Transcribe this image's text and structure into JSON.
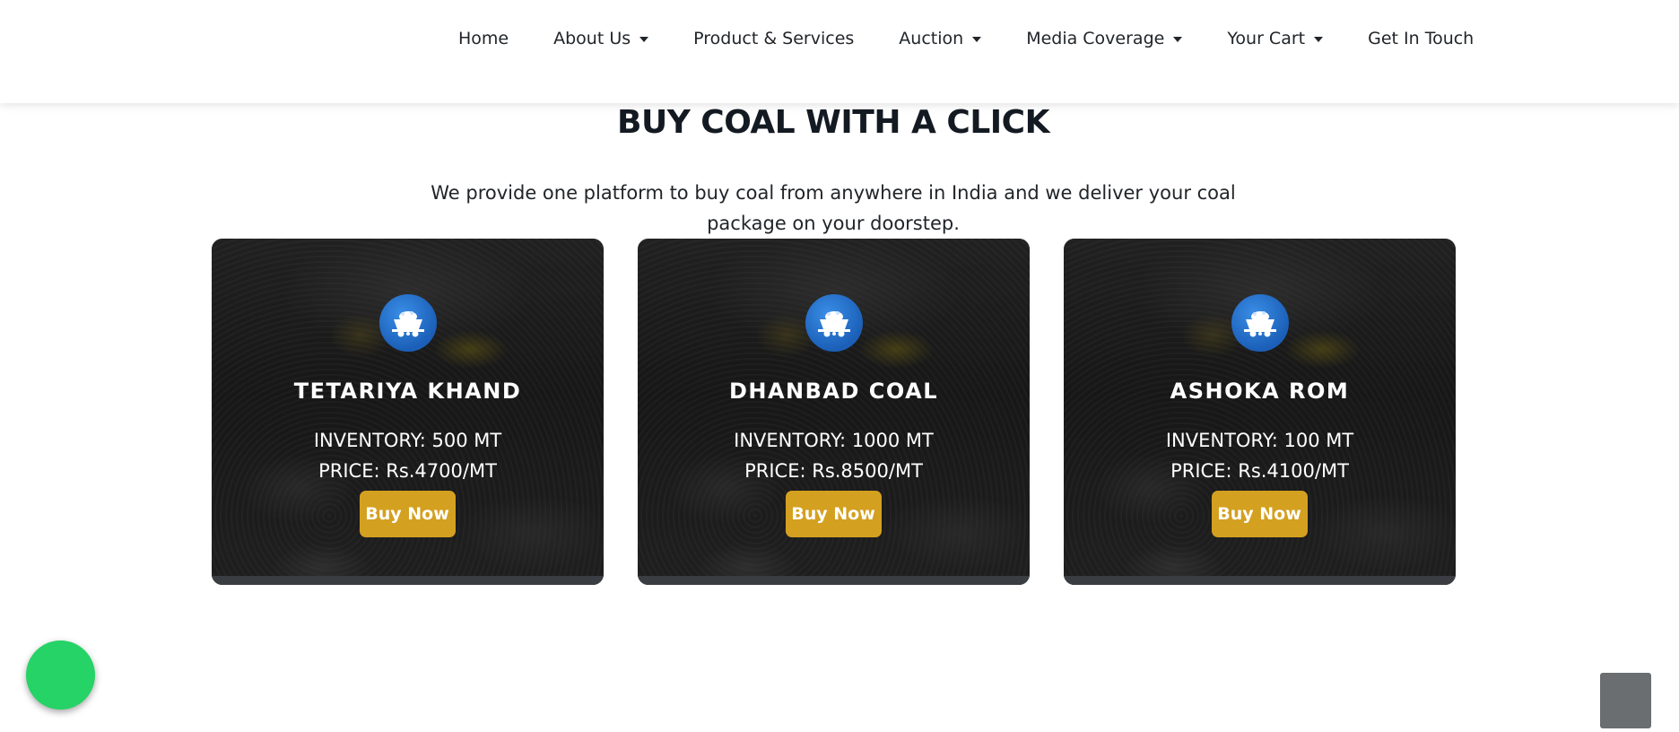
{
  "nav": {
    "items": [
      {
        "label": "Home",
        "dropdown": false
      },
      {
        "label": "About Us",
        "dropdown": true
      },
      {
        "label": "Product & Services",
        "dropdown": false
      },
      {
        "label": "Auction",
        "dropdown": true
      },
      {
        "label": "Media Coverage",
        "dropdown": true
      },
      {
        "label": "Your Cart",
        "dropdown": true
      },
      {
        "label": "Get In Touch",
        "dropdown": false
      }
    ]
  },
  "section": {
    "title": "BUY COAL WITH A CLICK",
    "subtitle": "We provide one platform to buy coal from anywhere in India and we deliver your coal package on your doorstep."
  },
  "cards": [
    {
      "title": "TETARIYA KHAND",
      "inventory": "INVENTORY: 500 MT",
      "price": "PRICE: Rs.4700/MT",
      "button": "Buy Now",
      "icon": "coal-cart-icon"
    },
    {
      "title": "DHANBAD COAL",
      "inventory": "INVENTORY: 1000 MT",
      "price": "PRICE: Rs.8500/MT",
      "button": "Buy Now",
      "icon": "coal-cart-icon"
    },
    {
      "title": "ASHOKA ROM",
      "inventory": "INVENTORY: 100 MT",
      "price": "PRICE: Rs.4100/MT",
      "button": "Buy Now",
      "icon": "coal-cart-icon"
    }
  ],
  "floating": {
    "whatsapp_icon": "whatsapp-icon",
    "whatsapp_glyph": "",
    "scroll_top_icon": "arrow-up-icon",
    "scroll_top_glyph": ""
  },
  "colors": {
    "accent": "#d4a020",
    "whatsapp": "#25d366",
    "icon_blue": "#1b5fb8",
    "scroll_top": "#6b6e70"
  }
}
